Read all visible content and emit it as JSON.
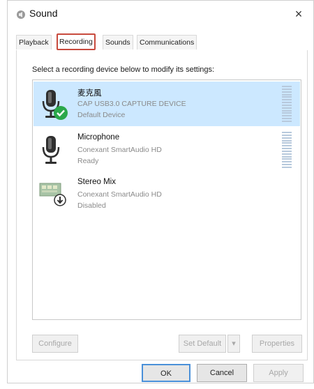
{
  "window": {
    "title": "Sound",
    "close_glyph": "×"
  },
  "tabs": [
    {
      "label": "Playback",
      "active": false
    },
    {
      "label": "Recording",
      "active": true
    },
    {
      "label": "Sounds",
      "active": false
    },
    {
      "label": "Communications",
      "active": false
    }
  ],
  "instruction": "Select a recording device below to modify its settings:",
  "devices": [
    {
      "name": "麦克風",
      "description": "CAP USB3.0 CAPTURE DEVICE",
      "status": "Default Device",
      "icon": "microphone-default-icon",
      "selected": true
    },
    {
      "name": "Microphone",
      "description": "Conexant SmartAudio HD",
      "status": "Ready",
      "icon": "microphone-icon",
      "selected": false
    },
    {
      "name": "Stereo Mix",
      "description": "Conexant SmartAudio HD",
      "status": "Disabled",
      "icon": "sound-card-disabled-icon",
      "selected": false
    }
  ],
  "buttons": {
    "configure": "Configure",
    "set_default": "Set Default",
    "properties": "Properties",
    "ok": "OK",
    "cancel": "Cancel",
    "apply": "Apply"
  },
  "colors": {
    "selection": "#cce8ff",
    "active_tab_highlight": "#c84a3d",
    "default_check": "#2aa84a"
  }
}
